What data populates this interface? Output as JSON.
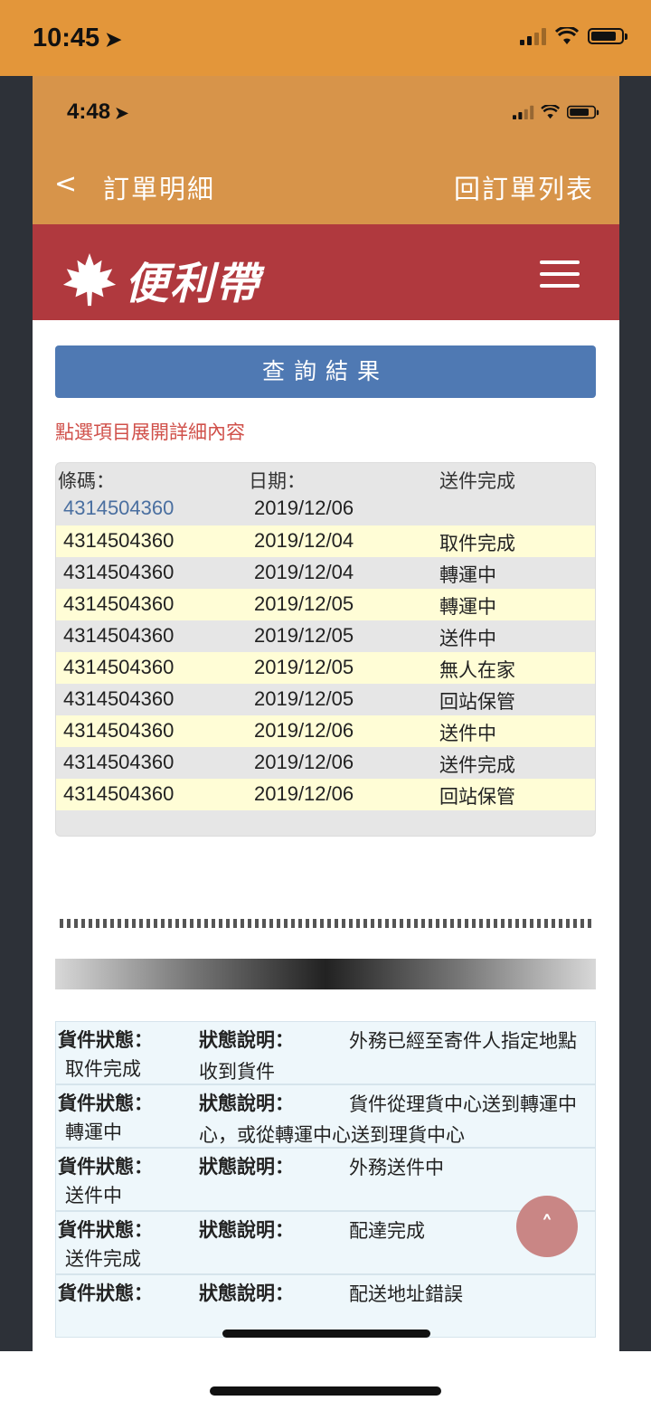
{
  "outer_status": {
    "time": "10:45",
    "battery_level": 0.85
  },
  "inner_status": {
    "time": "4:48",
    "battery_level": 0.8
  },
  "nav": {
    "back": "<",
    "title": "訂單明細",
    "right_link": "回訂單列表"
  },
  "brand": {
    "name": "便利帶",
    "accent": "#b0393e"
  },
  "query": {
    "button": "查詢結果",
    "hint": "點選項目展開詳細內容"
  },
  "table": {
    "headers": [
      "條碼：",
      "日期：",
      "送件完成"
    ],
    "first_row": {
      "barcode": "4314504360",
      "date": "2019/12/06"
    },
    "rows": [
      {
        "barcode": "4314504360",
        "date": "2019/12/04",
        "status": "取件完成"
      },
      {
        "barcode": "4314504360",
        "date": "2019/12/04",
        "status": "轉運中"
      },
      {
        "barcode": "4314504360",
        "date": "2019/12/05",
        "status": "轉運中"
      },
      {
        "barcode": "4314504360",
        "date": "2019/12/05",
        "status": "送件中"
      },
      {
        "barcode": "4314504360",
        "date": "2019/12/05",
        "status": "無人在家"
      },
      {
        "barcode": "4314504360",
        "date": "2019/12/05",
        "status": "回站保管"
      },
      {
        "barcode": "4314504360",
        "date": "2019/12/06",
        "status": "送件中"
      },
      {
        "barcode": "4314504360",
        "date": "2019/12/06",
        "status": "送件完成"
      },
      {
        "barcode": "4314504360",
        "date": "2019/12/06",
        "status": "回站保管"
      }
    ]
  },
  "status_details": {
    "label_status": "貨件狀態：",
    "label_desc": "狀態說明：",
    "items": [
      {
        "status": "取件完成",
        "desc": "外務已經至寄件人指定地點收到貨件"
      },
      {
        "status": "轉運中",
        "desc": "貨件從理貨中心送到轉運中心，或從轉運中心送到理貨中心"
      },
      {
        "status": "送件中",
        "desc": "外務送件中"
      },
      {
        "status": "送件完成",
        "desc": "配達完成"
      },
      {
        "status": "",
        "desc": "配送地址錯誤"
      }
    ]
  },
  "scroll_top": "˄"
}
